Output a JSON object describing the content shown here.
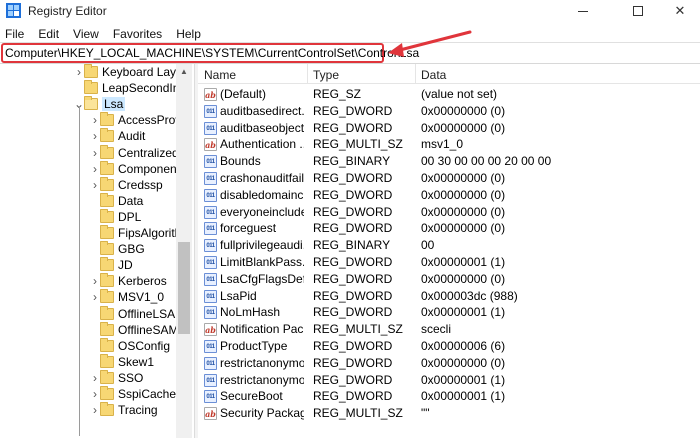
{
  "window": {
    "title": "Registry Editor"
  },
  "menu": [
    "File",
    "Edit",
    "View",
    "Favorites",
    "Help"
  ],
  "address": {
    "path": "Computer\\HKEY_LOCAL_MACHINE\\SYSTEM\\CurrentControlSet\\Control\\Lsa"
  },
  "tree": [
    {
      "label": "Keyboard Layo",
      "level": 1,
      "expandable": true,
      "expanded": false,
      "selected": false
    },
    {
      "label": "LeapSecondInf",
      "level": 1,
      "expandable": false,
      "expanded": false,
      "selected": false
    },
    {
      "label": "Lsa",
      "level": 1,
      "expandable": true,
      "expanded": true,
      "selected": true
    },
    {
      "label": "AccessProvi",
      "level": 2,
      "expandable": true,
      "expanded": false,
      "selected": false
    },
    {
      "label": "Audit",
      "level": 2,
      "expandable": true,
      "expanded": false,
      "selected": false
    },
    {
      "label": "CentralizedA",
      "level": 2,
      "expandable": true,
      "expanded": false,
      "selected": false
    },
    {
      "label": "Component",
      "level": 2,
      "expandable": true,
      "expanded": false,
      "selected": false
    },
    {
      "label": "Credssp",
      "level": 2,
      "expandable": true,
      "expanded": false,
      "selected": false
    },
    {
      "label": "Data",
      "level": 2,
      "expandable": false,
      "expanded": false,
      "selected": false
    },
    {
      "label": "DPL",
      "level": 2,
      "expandable": false,
      "expanded": false,
      "selected": false
    },
    {
      "label": "FipsAlgorith",
      "level": 2,
      "expandable": false,
      "expanded": false,
      "selected": false
    },
    {
      "label": "GBG",
      "level": 2,
      "expandable": false,
      "expanded": false,
      "selected": false
    },
    {
      "label": "JD",
      "level": 2,
      "expandable": false,
      "expanded": false,
      "selected": false
    },
    {
      "label": "Kerberos",
      "level": 2,
      "expandable": true,
      "expanded": false,
      "selected": false
    },
    {
      "label": "MSV1_0",
      "level": 2,
      "expandable": true,
      "expanded": false,
      "selected": false
    },
    {
      "label": "OfflineLSA",
      "level": 2,
      "expandable": false,
      "expanded": false,
      "selected": false
    },
    {
      "label": "OfflineSAM",
      "level": 2,
      "expandable": false,
      "expanded": false,
      "selected": false
    },
    {
      "label": "OSConfig",
      "level": 2,
      "expandable": false,
      "expanded": false,
      "selected": false
    },
    {
      "label": "Skew1",
      "level": 2,
      "expandable": false,
      "expanded": false,
      "selected": false
    },
    {
      "label": "SSO",
      "level": 2,
      "expandable": true,
      "expanded": false,
      "selected": false
    },
    {
      "label": "SspiCache",
      "level": 2,
      "expandable": true,
      "expanded": false,
      "selected": false
    },
    {
      "label": "Tracing",
      "level": 2,
      "expandable": true,
      "expanded": false,
      "selected": false
    }
  ],
  "columns": {
    "name": "Name",
    "type": "Type",
    "data": "Data"
  },
  "values": [
    {
      "icon": "string-value-icon",
      "name": "(Default)",
      "type": "REG_SZ",
      "data": "(value not set)"
    },
    {
      "icon": "binary-value-icon",
      "name": "auditbasedirect...",
      "type": "REG_DWORD",
      "data": "0x00000000 (0)"
    },
    {
      "icon": "binary-value-icon",
      "name": "auditbaseobjects",
      "type": "REG_DWORD",
      "data": "0x00000000 (0)"
    },
    {
      "icon": "string-value-icon",
      "name": "Authentication ...",
      "type": "REG_MULTI_SZ",
      "data": "msv1_0"
    },
    {
      "icon": "binary-value-icon",
      "name": "Bounds",
      "type": "REG_BINARY",
      "data": "00 30 00 00 00 20 00 00"
    },
    {
      "icon": "binary-value-icon",
      "name": "crashonauditfail",
      "type": "REG_DWORD",
      "data": "0x00000000 (0)"
    },
    {
      "icon": "binary-value-icon",
      "name": "disabledomainc...",
      "type": "REG_DWORD",
      "data": "0x00000000 (0)"
    },
    {
      "icon": "binary-value-icon",
      "name": "everyoneinclude...",
      "type": "REG_DWORD",
      "data": "0x00000000 (0)"
    },
    {
      "icon": "binary-value-icon",
      "name": "forceguest",
      "type": "REG_DWORD",
      "data": "0x00000000 (0)"
    },
    {
      "icon": "binary-value-icon",
      "name": "fullprivilegeaudi...",
      "type": "REG_BINARY",
      "data": "00"
    },
    {
      "icon": "binary-value-icon",
      "name": "LimitBlankPass...",
      "type": "REG_DWORD",
      "data": "0x00000001 (1)"
    },
    {
      "icon": "binary-value-icon",
      "name": "LsaCfgFlagsDefa...",
      "type": "REG_DWORD",
      "data": "0x00000000 (0)"
    },
    {
      "icon": "binary-value-icon",
      "name": "LsaPid",
      "type": "REG_DWORD",
      "data": "0x000003dc (988)"
    },
    {
      "icon": "binary-value-icon",
      "name": "NoLmHash",
      "type": "REG_DWORD",
      "data": "0x00000001 (1)"
    },
    {
      "icon": "string-value-icon",
      "name": "Notification Pac...",
      "type": "REG_MULTI_SZ",
      "data": "scecli"
    },
    {
      "icon": "binary-value-icon",
      "name": "ProductType",
      "type": "REG_DWORD",
      "data": "0x00000006 (6)"
    },
    {
      "icon": "binary-value-icon",
      "name": "restrictanonymo...",
      "type": "REG_DWORD",
      "data": "0x00000000 (0)"
    },
    {
      "icon": "binary-value-icon",
      "name": "restrictanonymo...",
      "type": "REG_DWORD",
      "data": "0x00000001 (1)"
    },
    {
      "icon": "binary-value-icon",
      "name": "SecureBoot",
      "type": "REG_DWORD",
      "data": "0x00000001 (1)"
    },
    {
      "icon": "string-value-icon",
      "name": "Security Packages",
      "type": "REG_MULTI_SZ",
      "data": "\"\""
    }
  ],
  "colors": {
    "highlight": "#e0353b",
    "selection": "#cce8ff",
    "folder": "#f7d774"
  }
}
